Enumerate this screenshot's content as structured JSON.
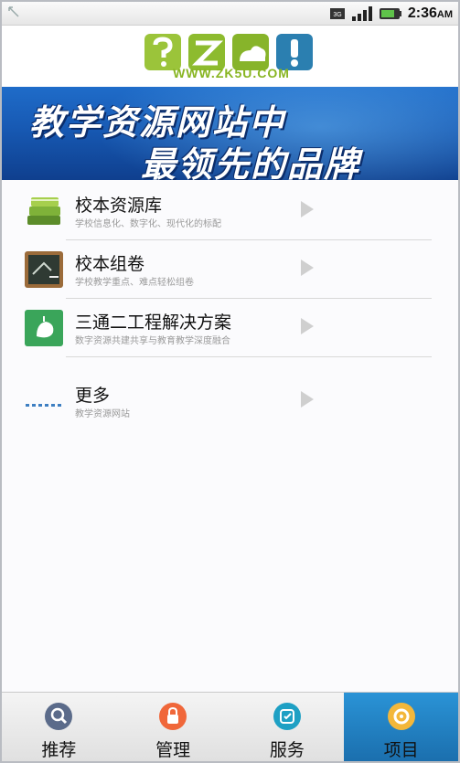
{
  "status_bar": {
    "time": "2:36",
    "ampm": "AM"
  },
  "header": {
    "logo_url": "WWW.ZK5U.COM"
  },
  "banner": {
    "line1": "教学资源网站中",
    "line2": "最领先的品牌"
  },
  "list": {
    "items": [
      {
        "title": "校本资源库",
        "subtitle": "学校信息化、数字化、现代化的标配",
        "icon": "books-icon"
      },
      {
        "title": "校本组卷",
        "subtitle": "学校教学重点、难点轻松组卷",
        "icon": "blackboard-icon"
      },
      {
        "title": "三通二工程解决方案",
        "subtitle": "数字资源共建共享与教育教学深度融合",
        "icon": "plant-icon"
      },
      {
        "title": "更多",
        "subtitle": "教学资源网站",
        "icon": "more-dots-icon"
      }
    ]
  },
  "nav": {
    "tabs": [
      {
        "label": "推荐",
        "icon": "magnifier-icon",
        "active": false
      },
      {
        "label": "管理",
        "icon": "lock-icon",
        "active": false
      },
      {
        "label": "服务",
        "icon": "service-icon",
        "active": false
      },
      {
        "label": "项目",
        "icon": "project-icon",
        "active": true
      }
    ]
  },
  "colors": {
    "banner_blue": "#1759b3",
    "logo_green": "#88b522",
    "nav_active": "#1b6fae"
  }
}
